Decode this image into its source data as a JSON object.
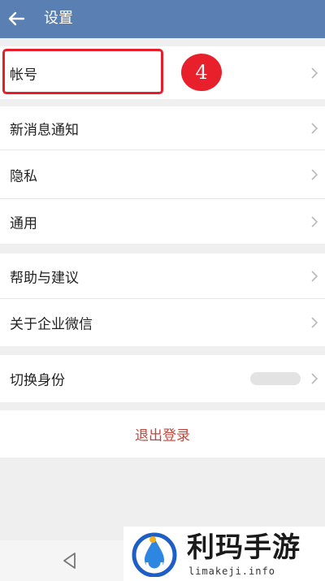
{
  "header": {
    "title": "设置",
    "back_icon": "arrow-left-icon"
  },
  "groups": {
    "account": {
      "label": "帐号"
    },
    "notifications": {
      "label": "新消息通知"
    },
    "privacy": {
      "label": "隐私"
    },
    "general": {
      "label": "通用"
    },
    "help": {
      "label": "帮助与建议"
    },
    "about": {
      "label": "关于企业微信"
    },
    "switch_identity": {
      "label": "切换身份"
    }
  },
  "annotation": {
    "step": "4",
    "color": "#e8202c"
  },
  "logout": {
    "label": "退出登录",
    "color": "#c4463b"
  },
  "watermark": {
    "title": "利玛手游",
    "url": "limakeji.info"
  },
  "colors": {
    "header_bg": "#5a7fb3",
    "page_bg": "#efefef"
  }
}
